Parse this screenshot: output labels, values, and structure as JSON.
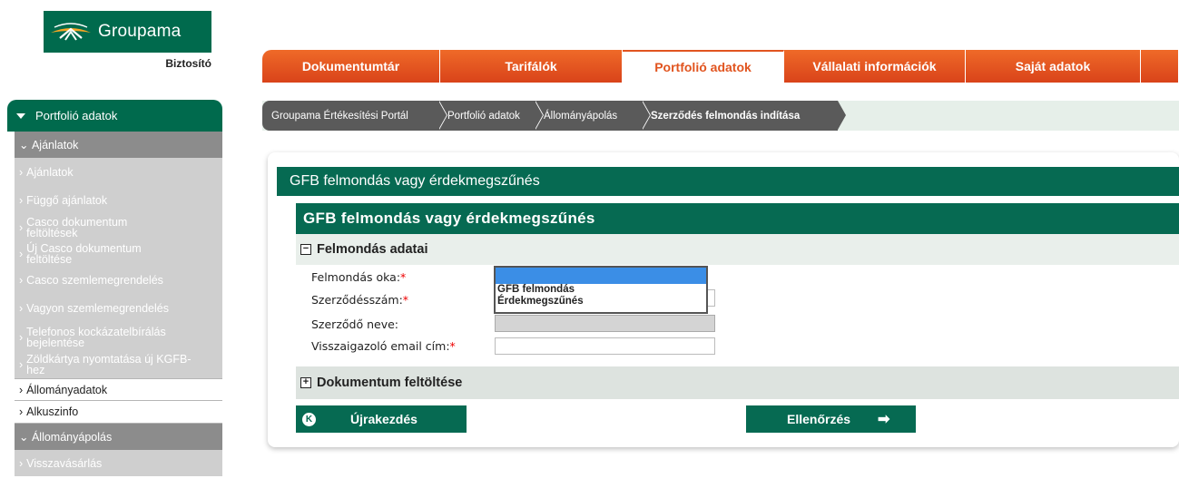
{
  "logo": {
    "brand": "Groupama",
    "sub": "Biztosító"
  },
  "topnav": [
    {
      "label": "Dokumentumtár",
      "active": false
    },
    {
      "label": "Tarifálók",
      "active": false
    },
    {
      "label": "Portfolió adatok",
      "active": true
    },
    {
      "label": "Vállalati információk",
      "active": false
    },
    {
      "label": "Saját adatok",
      "active": false
    }
  ],
  "breadcrumb": [
    "Groupama Értékesítési Portál",
    "Portfolió adatok",
    "Állományápolás",
    "Szerződés felmondás indítása"
  ],
  "sidebar": {
    "header": "Portfolió adatok",
    "sections": [
      {
        "label": "Ajánlatok"
      },
      {
        "label": "Állományápolás"
      }
    ],
    "items": [
      "Ajánlatok",
      "Függő ajánlatok",
      "Casco dokumentum feltöltések",
      "Új Casco dokumentum feltöltése",
      "Casco szemlemegrendelés",
      "Vagyon szemlemegrendelés",
      "Telefonos kockázatelbírálás bejelentése",
      "Zöldkártya nyomtatása új KGFB-hez",
      "Állományadatok",
      "Alkuszinfo",
      "Visszavásárlás"
    ]
  },
  "panel": {
    "title": "GFB felmondás vagy érdekmegszűnés",
    "form_title": "GFB felmondás vagy érdekmegszűnés",
    "section1": "Felmondás adatai",
    "section1_toggle": "−",
    "section2": "Dokumentum feltöltése",
    "section2_toggle": "+",
    "fields": {
      "reason": "Felmondás oka:",
      "contract_no": "Szerződésszám:",
      "contractor_name": "Szerződő neve:",
      "email": "Visszaigazoló email cím:",
      "required_mark": "*"
    },
    "reason_options": [
      "GFB felmondás",
      "Érdekmegszűnés"
    ],
    "buttons": {
      "restart": "Újrakezdés",
      "restart_icon": "K",
      "check": "Ellenőrzés",
      "check_icon": "➡"
    }
  },
  "colors": {
    "brand_green": "#066a52",
    "tab_orange": "#e1541f",
    "breadcrumb_grey": "#5a5a5a",
    "sidebar_grey": "#8c8c8c"
  }
}
